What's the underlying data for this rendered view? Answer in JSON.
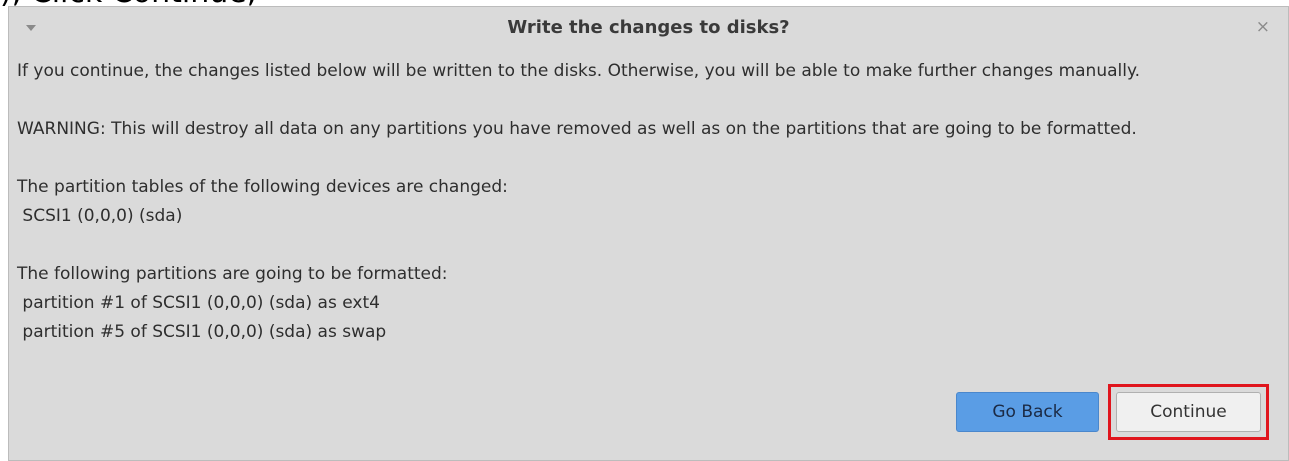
{
  "cut_text": "), Click Continue,",
  "dialog": {
    "title": "Write the changes to disks?",
    "close_glyph": "×",
    "lines": {
      "intro": "If you continue, the changes listed below will be written to the disks. Otherwise, you will be able to make further changes manually.",
      "warning": "WARNING: This will destroy all data on any partitions you have removed as well as on the partitions that are going to be formatted.",
      "tables_header": "The partition tables of the following devices are changed:",
      "device": " SCSI1 (0,0,0) (sda)",
      "formatted_header": "The following partitions are going to be formatted:",
      "partition1": " partition #1 of SCSI1 (0,0,0) (sda) as ext4",
      "partition5": " partition #5 of SCSI1 (0,0,0) (sda) as swap"
    },
    "buttons": {
      "back": "Go Back",
      "continue": "Continue"
    }
  },
  "colors": {
    "dialog_bg": "#dadada",
    "back_button": "#5a9de5",
    "highlight": "#e0151d"
  }
}
